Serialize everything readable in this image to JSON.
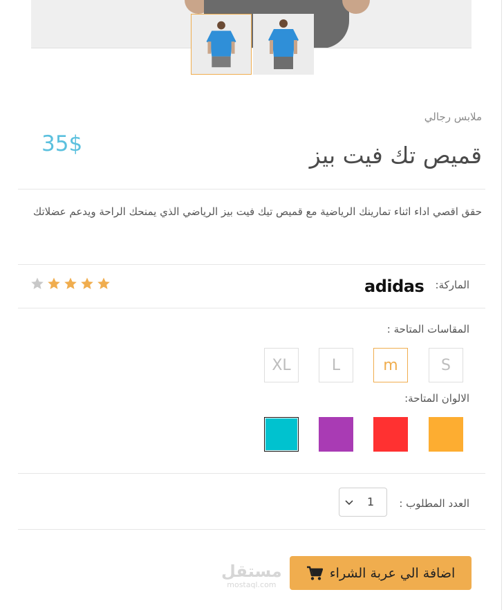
{
  "product": {
    "category": "ملابس رجالي",
    "title": "قميص تك فيت بيز",
    "price": "35$",
    "description": "حقق اقصي اداء اثناء تمارينك الرياضية مع قميص تيك فيت بيز الرياضي الذي يمنحك الراحة ويدعم عضلاتك",
    "rating": {
      "value": 4,
      "max": 5,
      "filled_color": "#f0ad4e",
      "empty_color": "#c8c8c8"
    }
  },
  "brand": {
    "label": "الماركة:",
    "name": "adidas"
  },
  "sizes": {
    "label": "المقاسات المتاحة :",
    "options": [
      "S",
      "m",
      "L",
      "XL"
    ],
    "selected": "m"
  },
  "colors": {
    "label": "الالوان المتاحة:",
    "options": [
      "#fdad31",
      "#ff3131",
      "#a93bb4",
      "#00c2cf"
    ],
    "selected": "#00c2cf"
  },
  "quantity": {
    "label": "العدد المطلوب :",
    "value": "1"
  },
  "cart_button": {
    "label": "اضافة الي عربة الشراء",
    "icon": "cart-icon"
  },
  "watermark": {
    "arabic": "مستقل",
    "latin": "mostaql.com"
  },
  "theme": {
    "accent": "#f0ad4e",
    "price_color": "#5bc0de",
    "shirt_color": "#2f8fd8"
  }
}
